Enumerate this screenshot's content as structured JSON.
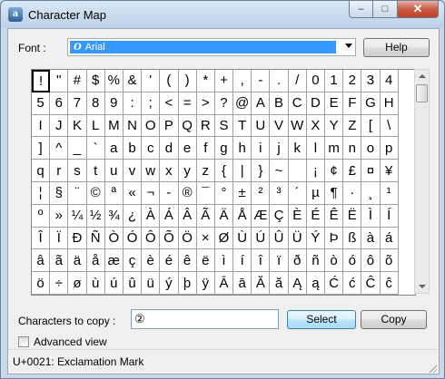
{
  "window": {
    "title": "Character Map",
    "app_icon_glyph": "a"
  },
  "caption_buttons": {
    "minimize": "–",
    "maximize": "□",
    "close": "✕"
  },
  "font": {
    "label": "Font :",
    "selected": "Arial",
    "icon_glyph": "O"
  },
  "buttons": {
    "help": "Help",
    "select": "Select",
    "copy": "Copy"
  },
  "characters": [
    "!",
    "\"",
    "#",
    "$",
    "%",
    "&",
    "'",
    "(",
    ")",
    "*",
    "+",
    ",",
    "-",
    ".",
    "/",
    "0",
    "1",
    "2",
    "3",
    "4",
    "5",
    "6",
    "7",
    "8",
    "9",
    ":",
    ";",
    "<",
    "=",
    ">",
    "?",
    "@",
    "A",
    "B",
    "C",
    "D",
    "E",
    "F",
    "G",
    "H",
    "I",
    "J",
    "K",
    "L",
    "M",
    "N",
    "O",
    "P",
    "Q",
    "R",
    "S",
    "T",
    "U",
    "V",
    "W",
    "X",
    "Y",
    "Z",
    "[",
    "\\",
    "]",
    "^",
    "_",
    "`",
    "a",
    "b",
    "c",
    "d",
    "e",
    "f",
    "g",
    "h",
    "i",
    "j",
    "k",
    "l",
    "m",
    "n",
    "o",
    "p",
    "q",
    "r",
    "s",
    "t",
    "u",
    "v",
    "w",
    "x",
    "y",
    "z",
    "{",
    "|",
    "}",
    "~",
    " ",
    "¡",
    "¢",
    "£",
    "¤",
    "¥",
    "¦",
    "§",
    "¨",
    "©",
    "ª",
    "«",
    "¬",
    "-",
    "®",
    "¯",
    "°",
    "±",
    "²",
    "³",
    "´",
    "µ",
    "¶",
    "·",
    "¸",
    "¹",
    "º",
    "»",
    "¼",
    "½",
    "¾",
    "¿",
    "À",
    "Á",
    "Â",
    "Ã",
    "Ä",
    "Å",
    "Æ",
    "Ç",
    "È",
    "É",
    "Ê",
    "Ë",
    "Ì",
    "Í",
    "Î",
    "Ï",
    "Ð",
    "Ñ",
    "Ò",
    "Ó",
    "Ô",
    "Õ",
    "Ö",
    "×",
    "Ø",
    "Ù",
    "Ú",
    "Û",
    "Ü",
    "Ý",
    "Þ",
    "ß",
    "à",
    "á",
    "â",
    "ã",
    "ä",
    "å",
    "æ",
    "ç",
    "è",
    "é",
    "ê",
    "ë",
    "ì",
    "í",
    "î",
    "ï",
    "ð",
    "ñ",
    "ò",
    "ó",
    "ô",
    "õ",
    "ö",
    "÷",
    "ø",
    "ù",
    "ú",
    "û",
    "ü",
    "ý",
    "þ",
    "ÿ",
    "Ā",
    "ā",
    "Ă",
    "ă",
    "Ą",
    "ą",
    "Ć",
    "ć",
    "Ĉ",
    "ĉ"
  ],
  "selected_index": 0,
  "characters_to_copy": {
    "label": "Characters to copy :",
    "value": "②"
  },
  "advanced_view": {
    "label": "Advanced view",
    "checked": false
  },
  "status": "U+0021: Exclamation Mark"
}
